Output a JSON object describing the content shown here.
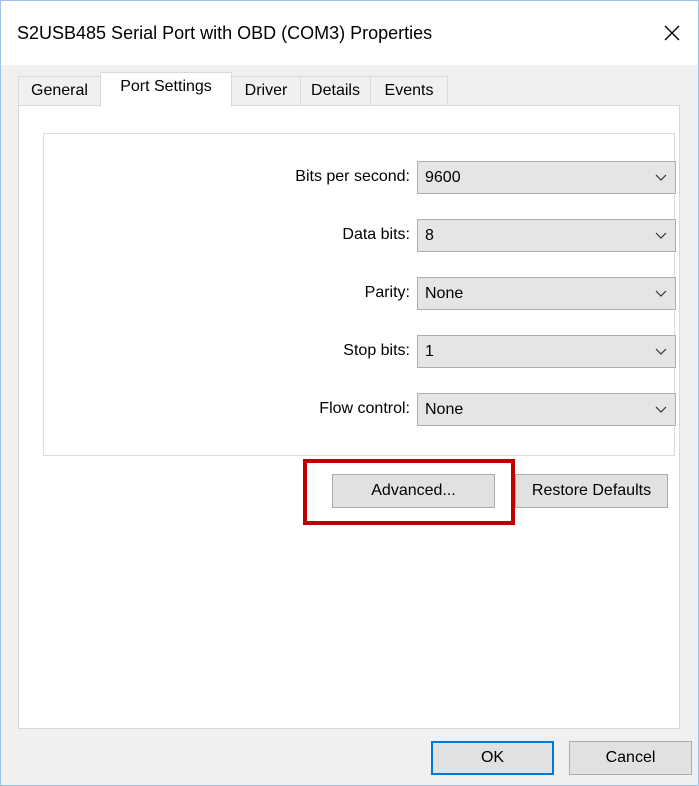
{
  "window": {
    "title": "S2USB485 Serial Port with OBD (COM3) Properties",
    "close_icon": "close-icon"
  },
  "tabs": [
    {
      "label": "General",
      "active": false
    },
    {
      "label": "Port Settings",
      "active": true
    },
    {
      "label": "Driver",
      "active": false
    },
    {
      "label": "Details",
      "active": false
    },
    {
      "label": "Events",
      "active": false
    }
  ],
  "port_settings": {
    "fields": [
      {
        "label": "Bits per second:",
        "value": "9600"
      },
      {
        "label": "Data bits:",
        "value": "8"
      },
      {
        "label": "Parity:",
        "value": "None"
      },
      {
        "label": "Stop bits:",
        "value": "1"
      },
      {
        "label": "Flow control:",
        "value": "None"
      }
    ],
    "advanced_label": "Advanced...",
    "restore_defaults_label": "Restore Defaults"
  },
  "footer": {
    "ok_label": "OK",
    "cancel_label": "Cancel"
  },
  "annotation": {
    "highlight_color": "#c00000"
  }
}
